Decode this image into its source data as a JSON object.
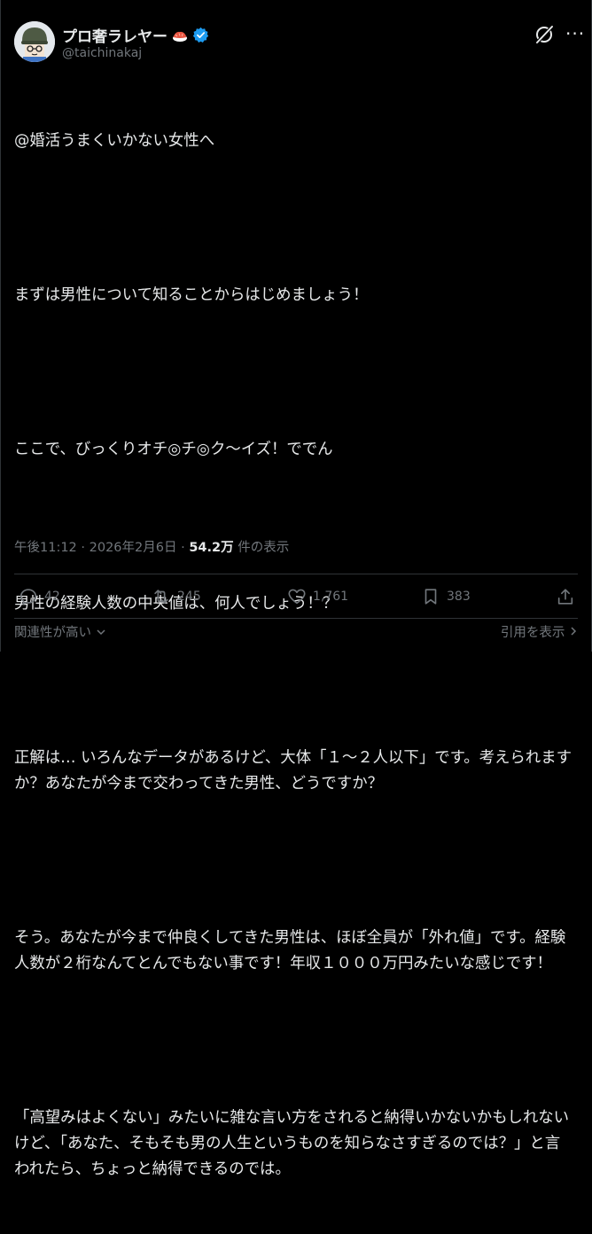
{
  "author": {
    "display_name": "プロ奢ラレヤー",
    "handle": "@taichinakaj",
    "avatar_icon": "avatar-helmet-character",
    "badge_icon": "verified-badge-icon",
    "emoji_icon": "sushi-emoji-icon"
  },
  "post": {
    "paragraphs": [
      "@婚活うまくいかない女性へ",
      "まずは男性について知ることからはじめましょう！",
      "ここで、びっくりオチ◎チ◎ク〜イズ！ででん",
      "男性の経験人数の中央値は、何人でしょう！？",
      "正解は… いろんなデータがあるけど、大体「１〜２人以下」です。考えられますか？あなたが今まで交わってきた男性、どうですか？",
      "そう。あなたが今まで仲良くしてきた男性は、ほぼ全員が「外れ値」です。経験人数が２桁なんてとんでもない事です！年収１０００万円みたいな感じです！",
      "「高望みはよくない」みたいに雑な言い方をされると納得いかないかもしれないけど、「あなた、そもそも男の人生というものを知らなさすぎるのでは？」と言われたら、ちょっと納得できるのでは。"
    ]
  },
  "meta": {
    "time": "午後11:12",
    "separator": "·",
    "date": "2026年2月6日",
    "views": "54.2万",
    "views_label": "件の表示"
  },
  "actions": {
    "replies": "42",
    "reposts": "245",
    "likes": "1,761",
    "bookmarks": "383"
  },
  "footer": {
    "sort_label": "関連性が高い",
    "quotes_label": "引用を表示"
  },
  "colors": {
    "background": "#000000",
    "text": "#e7e9ea",
    "muted": "#71767b",
    "border": "#2f3336",
    "verified": "#1d9bf0"
  }
}
